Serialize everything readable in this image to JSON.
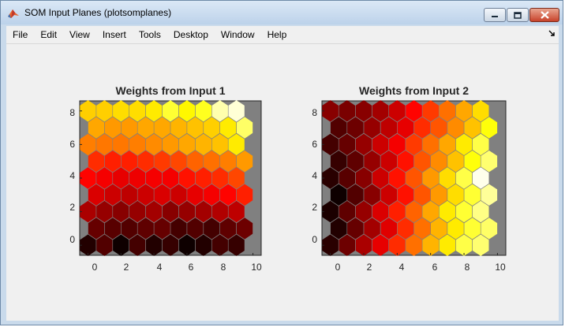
{
  "window": {
    "title": "SOM Input Planes (plotsomplanes)",
    "title_bar_color": "#c9daeb"
  },
  "menu": {
    "items": [
      "File",
      "Edit",
      "View",
      "Insert",
      "Tools",
      "Desktop",
      "Window",
      "Help"
    ],
    "dock_arrow_icon": "dock-arrow-icon"
  },
  "plots": [
    {
      "title": "Weights from Input 1",
      "xticks": [
        "0",
        "2",
        "4",
        "6",
        "8",
        "10"
      ],
      "yticks": [
        "0",
        "2",
        "4",
        "6",
        "8"
      ]
    },
    {
      "title": "Weights from Input 2",
      "xticks": [
        "0",
        "2",
        "4",
        "6",
        "8",
        "10"
      ],
      "yticks": [
        "0",
        "2",
        "4",
        "6",
        "8"
      ]
    }
  ],
  "chart_data": [
    {
      "type": "heatmap",
      "title": "Weights from Input 1",
      "grid": "hexagonal",
      "rows": 9,
      "cols": 10,
      "xlim": [
        -0.5,
        10.5
      ],
      "ylim": [
        -0.6,
        8.6
      ],
      "colormap": "hot",
      "background": "#808080",
      "values_by_row_bottom_to_top": [
        [
          0.05,
          0.12,
          0.02,
          0.1,
          0.05,
          0.08,
          0.02,
          0.05,
          0.1,
          0.08
        ],
        [
          0.15,
          0.13,
          0.12,
          0.14,
          0.15,
          0.1,
          0.12,
          0.1,
          0.14,
          0.16
        ],
        [
          0.25,
          0.22,
          0.2,
          0.22,
          0.24,
          0.2,
          0.22,
          0.24,
          0.26,
          0.28
        ],
        [
          0.32,
          0.3,
          0.28,
          0.3,
          0.32,
          0.3,
          0.34,
          0.36,
          0.38,
          0.42
        ],
        [
          0.38,
          0.36,
          0.34,
          0.35,
          0.36,
          0.36,
          0.4,
          0.42,
          0.44,
          0.48
        ],
        [
          0.44,
          0.42,
          0.42,
          0.44,
          0.46,
          0.48,
          0.52,
          0.54,
          0.56,
          0.6
        ],
        [
          0.56,
          0.55,
          0.55,
          0.56,
          0.58,
          0.6,
          0.62,
          0.64,
          0.66,
          0.72
        ],
        [
          0.62,
          0.6,
          0.6,
          0.62,
          0.62,
          0.64,
          0.66,
          0.68,
          0.72,
          0.85
        ],
        [
          0.68,
          0.68,
          0.7,
          0.7,
          0.72,
          0.8,
          0.74,
          0.78,
          0.92,
          0.96
        ]
      ]
    },
    {
      "type": "heatmap",
      "title": "Weights from Input 2",
      "grid": "hexagonal",
      "rows": 9,
      "cols": 10,
      "xlim": [
        -0.5,
        10.5
      ],
      "ylim": [
        -0.6,
        8.6
      ],
      "colormap": "hot",
      "background": "#808080",
      "values_by_row_bottom_to_top": [
        [
          0.06,
          0.16,
          0.25,
          0.34,
          0.44,
          0.54,
          0.64,
          0.72,
          0.82,
          0.86
        ],
        [
          0.05,
          0.15,
          0.24,
          0.33,
          0.44,
          0.54,
          0.64,
          0.72,
          0.8,
          0.85
        ],
        [
          0.04,
          0.14,
          0.22,
          0.32,
          0.42,
          0.52,
          0.62,
          0.72,
          0.8,
          0.88
        ],
        [
          0.02,
          0.12,
          0.2,
          0.3,
          0.4,
          0.5,
          0.6,
          0.7,
          0.8,
          0.9
        ],
        [
          0.06,
          0.13,
          0.2,
          0.3,
          0.4,
          0.5,
          0.6,
          0.7,
          0.82,
          0.98
        ],
        [
          0.08,
          0.14,
          0.22,
          0.3,
          0.4,
          0.5,
          0.58,
          0.66,
          0.76,
          0.86
        ],
        [
          0.1,
          0.15,
          0.22,
          0.3,
          0.36,
          0.46,
          0.54,
          0.62,
          0.72,
          0.82
        ],
        [
          0.12,
          0.16,
          0.22,
          0.28,
          0.34,
          0.44,
          0.5,
          0.58,
          0.66,
          0.76
        ],
        [
          0.2,
          0.18,
          0.2,
          0.24,
          0.3,
          0.38,
          0.46,
          0.54,
          0.62,
          0.7
        ]
      ]
    }
  ]
}
